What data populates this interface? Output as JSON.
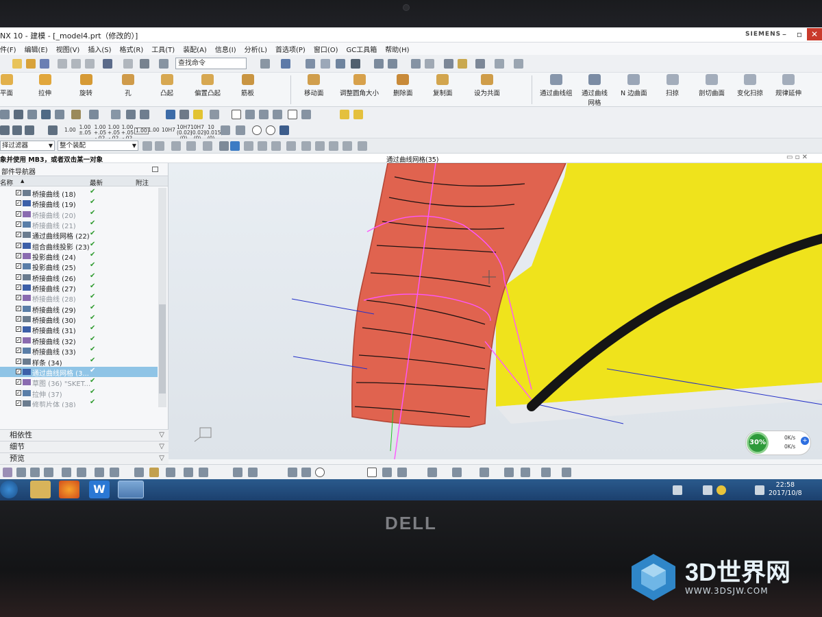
{
  "window": {
    "title": "NX 10 - 建模 - [_model4.prt（修改的）]",
    "brand": "SIEMENS"
  },
  "menu": [
    "件(F)",
    "编辑(E)",
    "视图(V)",
    "插入(S)",
    "格式(R)",
    "工具(T)",
    "装配(A)",
    "信息(I)",
    "分析(L)",
    "首选项(P)",
    "窗口(O)",
    "GC工具箱",
    "帮助(H)"
  ],
  "search": {
    "placeholder": "查找命令"
  },
  "ribbon": {
    "feature_group": [
      "平面",
      "拉伸",
      "旋转",
      "孔",
      "凸起",
      "偏置凸起",
      "筋板"
    ],
    "sync_group": [
      "移动面",
      "调整圆角大小",
      "删除面",
      "复制面",
      "设为共面"
    ],
    "surface_group": [
      "通过曲线组",
      "通过曲线网格",
      "N 边曲面",
      "扫掠",
      "剖切曲面",
      "变化扫掠",
      "规律延伸"
    ]
  },
  "precision_buttons": [
    "1.00",
    "1.00 ±.05",
    "1.00 +.05 -.02",
    "1.00 +.05 -.02",
    "1.00 +.05 -.02",
    "1.00",
    "1.00",
    "10H7",
    "10H7 (0.02) (0)",
    "10H7 (0.02) (0)",
    "10 (0.015) (0)"
  ],
  "filter": {
    "type_filter": "择过滤器",
    "scope": "整个装配"
  },
  "status": {
    "prompt": "象并使用 MB3，或者双击某一对象",
    "active_command": "通过曲线网格(35)"
  },
  "navigator": {
    "title": "部件导航器",
    "columns": {
      "name": "名称",
      "latest": "最新",
      "comment": "附注"
    },
    "items": [
      {
        "label": "桥接曲线 (18)",
        "gray": false,
        "latest": "✔"
      },
      {
        "label": "桥接曲线 (19)",
        "gray": false,
        "latest": "✔"
      },
      {
        "label": "桥接曲线 (20)",
        "gray": true,
        "latest": "✔"
      },
      {
        "label": "桥接曲线 (21)",
        "gray": true,
        "latest": "✔"
      },
      {
        "label": "通过曲线网格 (22)",
        "gray": false,
        "latest": "✔"
      },
      {
        "label": "组合曲线投影 (23)",
        "gray": false,
        "latest": "✔"
      },
      {
        "label": "投影曲线 (24)",
        "gray": false,
        "latest": "✔"
      },
      {
        "label": "投影曲线 (25)",
        "gray": false,
        "latest": "✔"
      },
      {
        "label": "桥接曲线 (26)",
        "gray": false,
        "latest": "✔"
      },
      {
        "label": "桥接曲线 (27)",
        "gray": false,
        "latest": "✔"
      },
      {
        "label": "桥接曲线 (28)",
        "gray": true,
        "latest": "✔"
      },
      {
        "label": "桥接曲线 (29)",
        "gray": false,
        "latest": "✔"
      },
      {
        "label": "桥接曲线 (30)",
        "gray": false,
        "latest": "✔"
      },
      {
        "label": "桥接曲线 (31)",
        "gray": false,
        "latest": "✔"
      },
      {
        "label": "桥接曲线 (32)",
        "gray": false,
        "latest": "✔"
      },
      {
        "label": "桥接曲线 (33)",
        "gray": false,
        "latest": "✔"
      },
      {
        "label": "样条 (34)",
        "gray": false,
        "latest": "✔"
      },
      {
        "label": "通过曲线网格 (3...",
        "gray": false,
        "selected": true,
        "latest": "✔"
      },
      {
        "label": "草图 (36) \"SKET...",
        "gray": true,
        "latest": "✔"
      },
      {
        "label": "拉伸 (37)",
        "gray": true,
        "latest": "✔"
      },
      {
        "label": "修剪片体 (38)",
        "gray": true,
        "latest": "✔"
      }
    ],
    "panels": [
      "相依性",
      "细节",
      "预览"
    ]
  },
  "performance": {
    "percent": "30%",
    "up": "0K/s",
    "down": "0K/s"
  },
  "clock": {
    "time": "22:58",
    "date": "2017/10/8"
  },
  "laptop": {
    "brand": "DELL"
  },
  "watermark": {
    "title": "3D世界网",
    "url": "WWW.3DSJW.COM"
  },
  "colors": {
    "surface": "#e0634f",
    "yellow_body": "#f0e21a",
    "highlight": "#ff55ff",
    "axis_blue": "#2430c8"
  }
}
